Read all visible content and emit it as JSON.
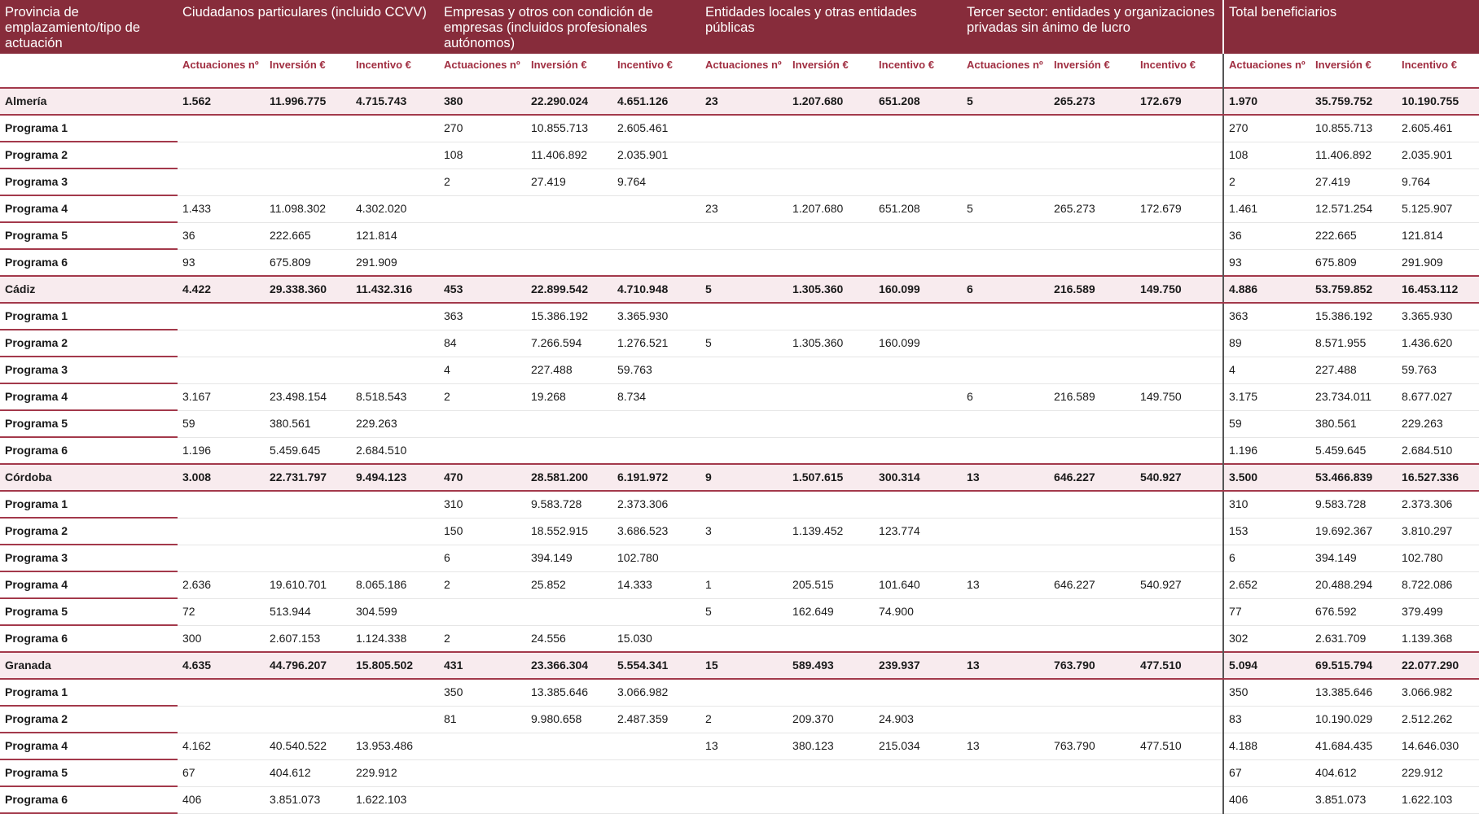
{
  "header": {
    "first_col": "Provincia de emplazamiento/tipo de actuación",
    "groups": [
      "Ciudadanos particulares (incluido CCVV)",
      "Empresas y otros con condición de empresas (incluidos profesionales autónomos)",
      "Entidades locales y otras entidades públicas",
      "Tercer sector: entidades y organizaciones privadas sin ánimo de lucro",
      "Total beneficiarios"
    ],
    "sub": [
      "Actuaciones nº",
      "Inversión €",
      "Incentivo €"
    ]
  },
  "rows": [
    {
      "type": "province",
      "label": "Almería",
      "cells": [
        "1.562",
        "11.996.775",
        "4.715.743",
        "380",
        "22.290.024",
        "4.651.126",
        "23",
        "1.207.680",
        "651.208",
        "5",
        "265.273",
        "172.679",
        "1.970",
        "35.759.752",
        "10.190.755"
      ]
    },
    {
      "type": "program",
      "label": "Programa 1",
      "cells": [
        "",
        "",
        "",
        "270",
        "10.855.713",
        "2.605.461",
        "",
        "",
        "",
        "",
        "",
        "",
        "270",
        "10.855.713",
        "2.605.461"
      ]
    },
    {
      "type": "program",
      "label": "Programa 2",
      "cells": [
        "",
        "",
        "",
        "108",
        "11.406.892",
        "2.035.901",
        "",
        "",
        "",
        "",
        "",
        "",
        "108",
        "11.406.892",
        "2.035.901"
      ]
    },
    {
      "type": "program",
      "label": "Programa 3",
      "cells": [
        "",
        "",
        "",
        "2",
        "27.419",
        "9.764",
        "",
        "",
        "",
        "",
        "",
        "",
        "2",
        "27.419",
        "9.764"
      ]
    },
    {
      "type": "program",
      "label": "Programa 4",
      "cells": [
        "1.433",
        "11.098.302",
        "4.302.020",
        "",
        "",
        "",
        "23",
        "1.207.680",
        "651.208",
        "5",
        "265.273",
        "172.679",
        "1.461",
        "12.571.254",
        "5.125.907"
      ]
    },
    {
      "type": "program",
      "label": "Programa 5",
      "cells": [
        "36",
        "222.665",
        "121.814",
        "",
        "",
        "",
        "",
        "",
        "",
        "",
        "",
        "",
        "36",
        "222.665",
        "121.814"
      ]
    },
    {
      "type": "program",
      "label": "Programa 6",
      "cells": [
        "93",
        "675.809",
        "291.909",
        "",
        "",
        "",
        "",
        "",
        "",
        "",
        "",
        "",
        "93",
        "675.809",
        "291.909"
      ]
    },
    {
      "type": "province",
      "label": "Cádiz",
      "cells": [
        "4.422",
        "29.338.360",
        "11.432.316",
        "453",
        "22.899.542",
        "4.710.948",
        "5",
        "1.305.360",
        "160.099",
        "6",
        "216.589",
        "149.750",
        "4.886",
        "53.759.852",
        "16.453.112"
      ]
    },
    {
      "type": "program",
      "label": "Programa 1",
      "cells": [
        "",
        "",
        "",
        "363",
        "15.386.192",
        "3.365.930",
        "",
        "",
        "",
        "",
        "",
        "",
        "363",
        "15.386.192",
        "3.365.930"
      ]
    },
    {
      "type": "program",
      "label": "Programa 2",
      "cells": [
        "",
        "",
        "",
        "84",
        "7.266.594",
        "1.276.521",
        "5",
        "1.305.360",
        "160.099",
        "",
        "",
        "",
        "89",
        "8.571.955",
        "1.436.620"
      ]
    },
    {
      "type": "program",
      "label": "Programa 3",
      "cells": [
        "",
        "",
        "",
        "4",
        "227.488",
        "59.763",
        "",
        "",
        "",
        "",
        "",
        "",
        "4",
        "227.488",
        "59.763"
      ]
    },
    {
      "type": "program",
      "label": "Programa 4",
      "cells": [
        "3.167",
        "23.498.154",
        "8.518.543",
        "2",
        "19.268",
        "8.734",
        "",
        "",
        "",
        "6",
        "216.589",
        "149.750",
        "3.175",
        "23.734.011",
        "8.677.027"
      ]
    },
    {
      "type": "program",
      "label": "Programa 5",
      "cells": [
        "59",
        "380.561",
        "229.263",
        "",
        "",
        "",
        "",
        "",
        "",
        "",
        "",
        "",
        "59",
        "380.561",
        "229.263"
      ]
    },
    {
      "type": "program",
      "label": "Programa 6",
      "cells": [
        "1.196",
        "5.459.645",
        "2.684.510",
        "",
        "",
        "",
        "",
        "",
        "",
        "",
        "",
        "",
        "1.196",
        "5.459.645",
        "2.684.510"
      ]
    },
    {
      "type": "province",
      "label": "Córdoba",
      "cells": [
        "3.008",
        "22.731.797",
        "9.494.123",
        "470",
        "28.581.200",
        "6.191.972",
        "9",
        "1.507.615",
        "300.314",
        "13",
        "646.227",
        "540.927",
        "3.500",
        "53.466.839",
        "16.527.336"
      ]
    },
    {
      "type": "program",
      "label": "Programa 1",
      "cells": [
        "",
        "",
        "",
        "310",
        "9.583.728",
        "2.373.306",
        "",
        "",
        "",
        "",
        "",
        "",
        "310",
        "9.583.728",
        "2.373.306"
      ]
    },
    {
      "type": "program",
      "label": "Programa 2",
      "cells": [
        "",
        "",
        "",
        "150",
        "18.552.915",
        "3.686.523",
        "3",
        "1.139.452",
        "123.774",
        "",
        "",
        "",
        "153",
        "19.692.367",
        "3.810.297"
      ]
    },
    {
      "type": "program",
      "label": "Programa 3",
      "cells": [
        "",
        "",
        "",
        "6",
        "394.149",
        "102.780",
        "",
        "",
        "",
        "",
        "",
        "",
        "6",
        "394.149",
        "102.780"
      ]
    },
    {
      "type": "program",
      "label": "Programa 4",
      "cells": [
        "2.636",
        "19.610.701",
        "8.065.186",
        "2",
        "25.852",
        "14.333",
        "1",
        "205.515",
        "101.640",
        "13",
        "646.227",
        "540.927",
        "2.652",
        "20.488.294",
        "8.722.086"
      ]
    },
    {
      "type": "program",
      "label": "Programa 5",
      "cells": [
        "72",
        "513.944",
        "304.599",
        "",
        "",
        "",
        "5",
        "162.649",
        "74.900",
        "",
        "",
        "",
        "77",
        "676.592",
        "379.499"
      ]
    },
    {
      "type": "program",
      "label": "Programa 6",
      "cells": [
        "300",
        "2.607.153",
        "1.124.338",
        "2",
        "24.556",
        "15.030",
        "",
        "",
        "",
        "",
        "",
        "",
        "302",
        "2.631.709",
        "1.139.368"
      ]
    },
    {
      "type": "province",
      "label": "Granada",
      "cells": [
        "4.635",
        "44.796.207",
        "15.805.502",
        "431",
        "23.366.304",
        "5.554.341",
        "15",
        "589.493",
        "239.937",
        "13",
        "763.790",
        "477.510",
        "5.094",
        "69.515.794",
        "22.077.290"
      ]
    },
    {
      "type": "program",
      "label": "Programa 1",
      "cells": [
        "",
        "",
        "",
        "350",
        "13.385.646",
        "3.066.982",
        "",
        "",
        "",
        "",
        "",
        "",
        "350",
        "13.385.646",
        "3.066.982"
      ]
    },
    {
      "type": "program",
      "label": "Programa 2",
      "cells": [
        "",
        "",
        "",
        "81",
        "9.980.658",
        "2.487.359",
        "2",
        "209.370",
        "24.903",
        "",
        "",
        "",
        "83",
        "10.190.029",
        "2.512.262"
      ]
    },
    {
      "type": "program",
      "label": "Programa 4",
      "cells": [
        "4.162",
        "40.540.522",
        "13.953.486",
        "",
        "",
        "",
        "13",
        "380.123",
        "215.034",
        "13",
        "763.790",
        "477.510",
        "4.188",
        "41.684.435",
        "14.646.030"
      ]
    },
    {
      "type": "program",
      "label": "Programa 5",
      "cells": [
        "67",
        "404.612",
        "229.912",
        "",
        "",
        "",
        "",
        "",
        "",
        "",
        "",
        "",
        "67",
        "404.612",
        "229.912"
      ]
    },
    {
      "type": "program",
      "label": "Programa 6",
      "cells": [
        "406",
        "3.851.073",
        "1.622.103",
        "",
        "",
        "",
        "",
        "",
        "",
        "",
        "",
        "",
        "406",
        "3.851.073",
        "1.622.103"
      ]
    }
  ]
}
